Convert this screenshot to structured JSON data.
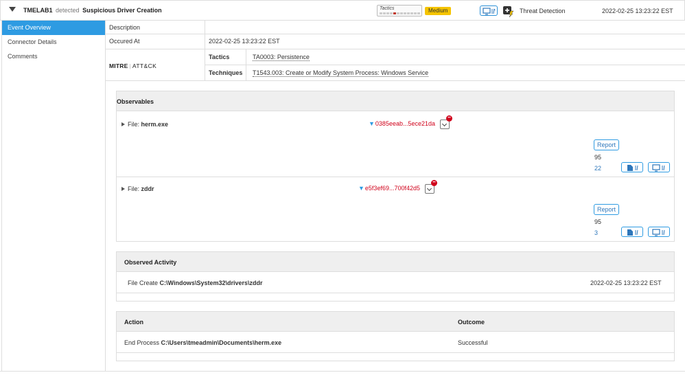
{
  "header": {
    "host": "TMELAB1",
    "detected_word": "detected",
    "event_name": "Suspicious Driver Creation",
    "tactics_label": "Tactics",
    "severity": "Medium",
    "category": "Threat Detection",
    "timestamp": "2022-02-25 13:23:22 EST",
    "colors": {
      "severity_bg": "#f5c400",
      "accent": "#2e9be2",
      "hash_red": "#d0021b"
    }
  },
  "sidebar": {
    "items": [
      {
        "label": "Event Overview",
        "active": true
      },
      {
        "label": "Connector Details",
        "active": false
      },
      {
        "label": "Comments",
        "active": false
      }
    ]
  },
  "overview": {
    "description_label": "Description",
    "description_value": "",
    "occurred_label": "Occured At",
    "occurred_value": "2022-02-25 13:23:22 EST",
    "mitre_brand": "MITRE",
    "mitre_attck": "ATT&CK",
    "tactics_label": "Tactics",
    "tactics_value": "TA0003: Persistence",
    "techniques_label": "Techniques",
    "techniques_value": "T1543.003: Create or Modify System Process: Windows Service"
  },
  "observables": {
    "title": "Observables",
    "items": [
      {
        "file_prefix": "File:",
        "file_name": "herm.exe",
        "hash": "0385eeab...5ece21da",
        "badge": "••",
        "report_label": "Report",
        "score": "95",
        "count": "22"
      },
      {
        "file_prefix": "File:",
        "file_name": "zddr",
        "hash": "e5f3ef69...700f42d5",
        "badge": "••",
        "report_label": "Report",
        "score": "95",
        "count": "3"
      }
    ]
  },
  "observed_activity": {
    "title": "Observed Activity",
    "rows": [
      {
        "action": "File Create",
        "path": "C:\\Windows\\System32\\drivers\\zddr",
        "time": "2022-02-25 13:23:22 EST"
      }
    ]
  },
  "actions": {
    "action_header": "Action",
    "outcome_header": "Outcome",
    "rows": [
      {
        "action": "End Process",
        "path": "C:\\Users\\tmeadmin\\Documents\\herm.exe",
        "outcome": "Successful"
      }
    ]
  },
  "icons": [
    "caret-down-icon",
    "monitor-icon",
    "plus-bolt-icon",
    "funnel-icon",
    "chevron-down-icon",
    "file-icon"
  ]
}
